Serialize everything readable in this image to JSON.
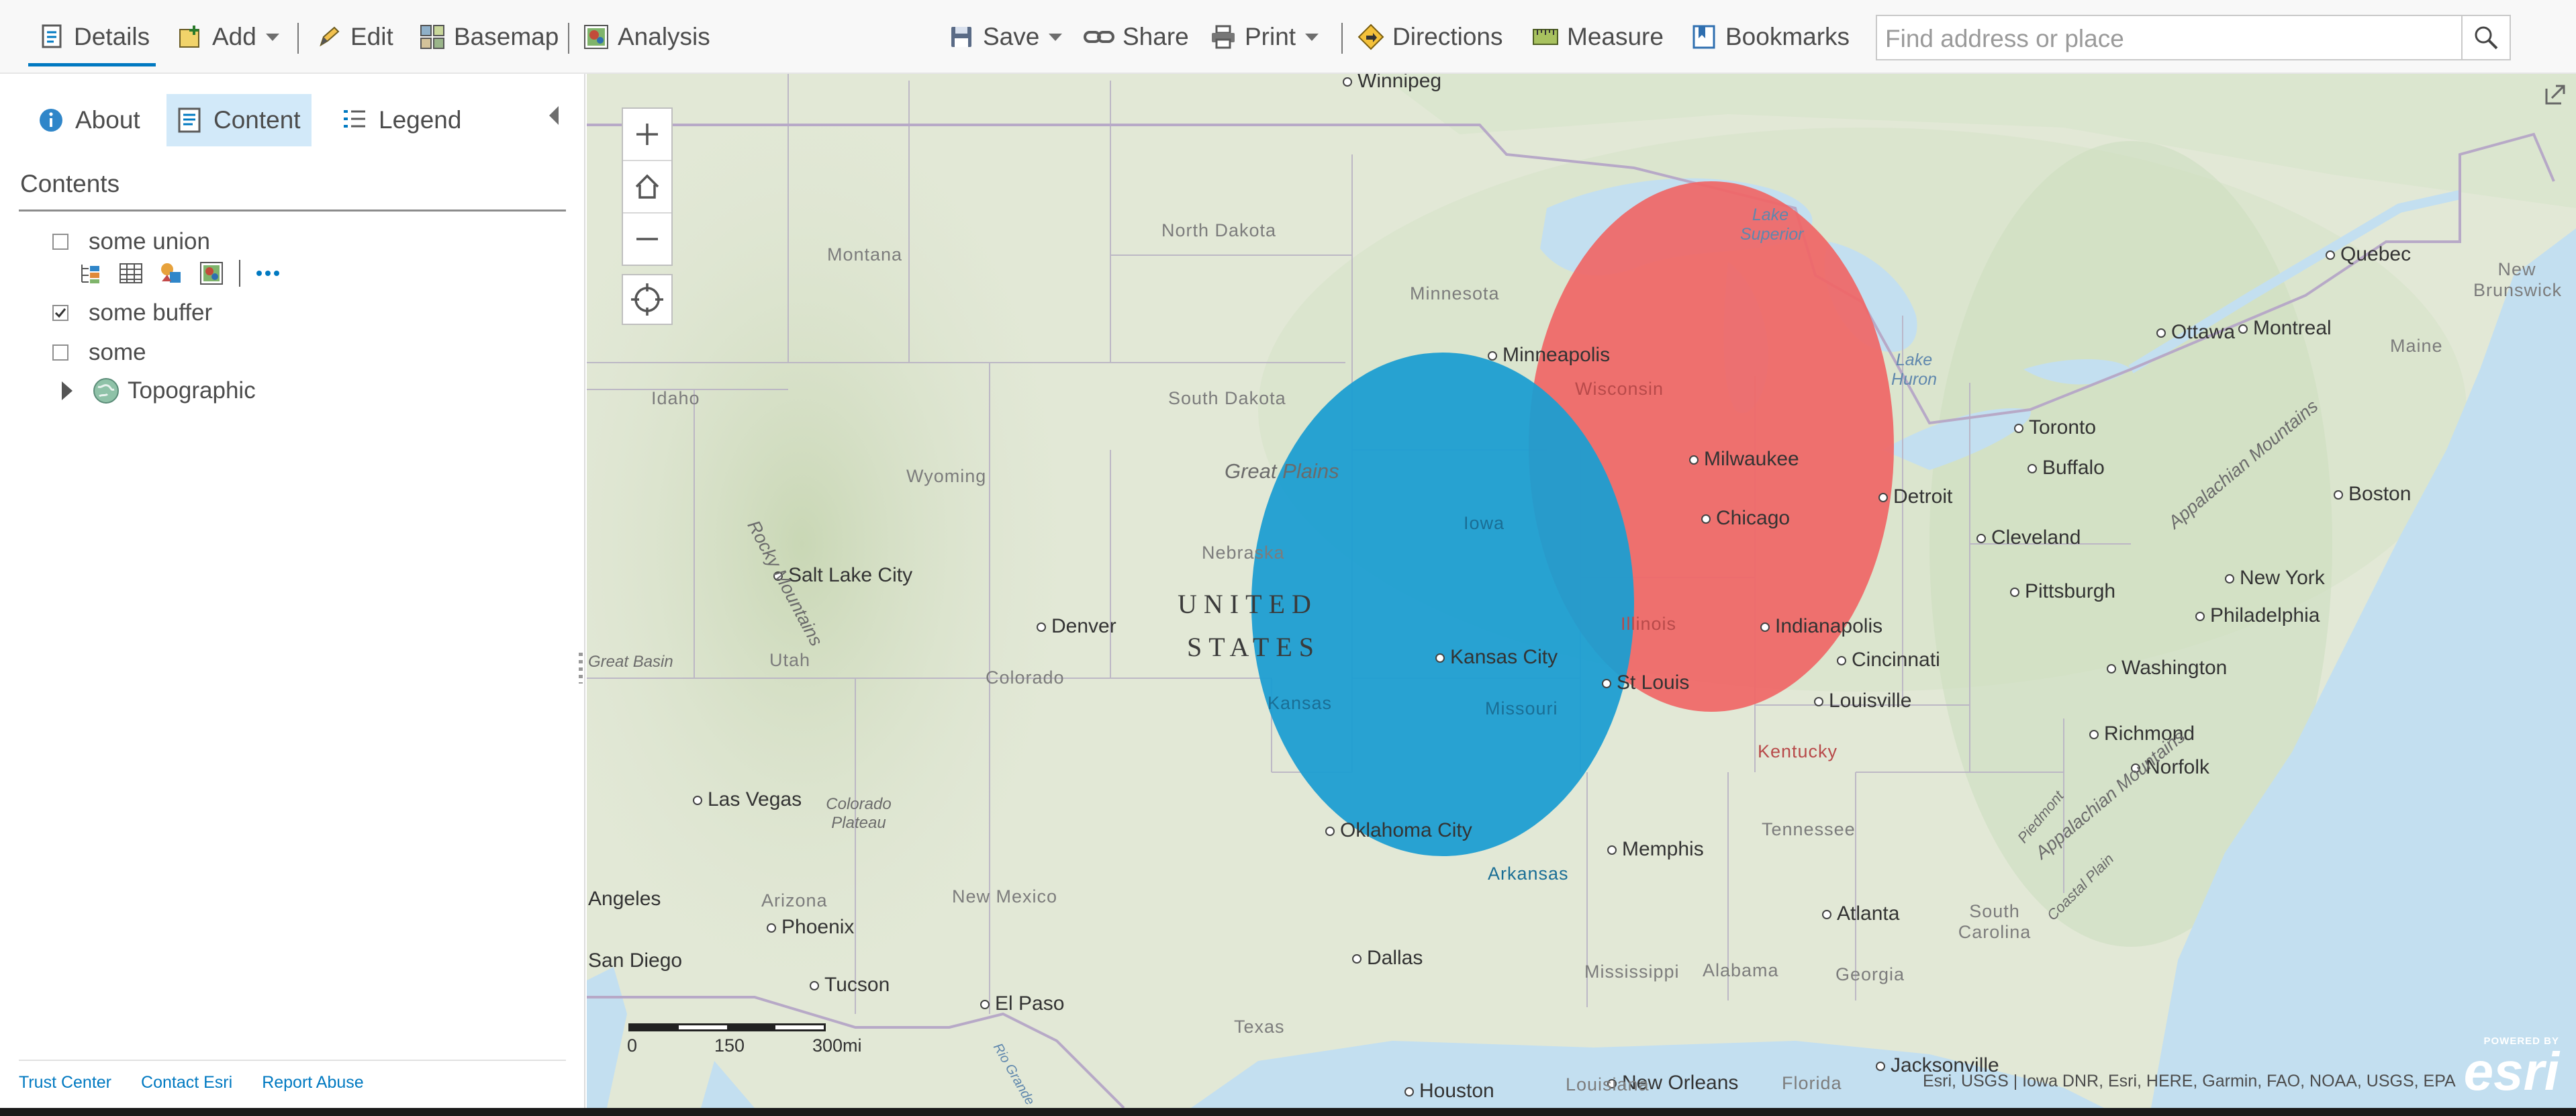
{
  "toolbar": {
    "details": "Details",
    "add": "Add",
    "edit": "Edit",
    "basemap": "Basemap",
    "analysis": "Analysis",
    "save": "Save",
    "share": "Share",
    "print": "Print",
    "directions": "Directions",
    "measure": "Measure",
    "bookmarks": "Bookmarks",
    "search_placeholder": "Find address or place"
  },
  "panel": {
    "tabs": {
      "about": "About",
      "content": "Content",
      "legend": "Legend"
    },
    "contents_title": "Contents",
    "layers": [
      {
        "label": "some union",
        "checked": false
      },
      {
        "label": "some buffer",
        "checked": true
      },
      {
        "label": "some",
        "checked": false
      },
      {
        "label": "Topographic",
        "checked": null
      }
    ],
    "footer": {
      "trust": "Trust Center",
      "contact": "Contact Esri",
      "abuse": "Report Abuse"
    }
  },
  "map": {
    "country": {
      "line1": "UNITED",
      "line2": "STATES"
    },
    "states": [
      "North Dakota",
      "Minnesota",
      "Montana",
      "South Dakota",
      "Wyoming",
      "Idaho",
      "Nebraska",
      "Iowa",
      "Wisconsin",
      "Illinois",
      "Kansas",
      "Missouri",
      "Colorado",
      "Utah",
      "Kentucky",
      "Tennessee",
      "Arkansas",
      "Arizona",
      "New Mexico",
      "Texas",
      "Mississippi",
      "Alabama",
      "Georgia",
      "South Carolina",
      "Louisiana",
      "Florida",
      "Maine",
      "New Brunswick"
    ],
    "cities": [
      "Winnipeg",
      "Minneapolis",
      "Milwaukee",
      "Chicago",
      "Detroit",
      "Toronto",
      "Buffalo",
      "Ottawa",
      "Montreal",
      "Quebec",
      "Boston",
      "Cleveland",
      "Pittsburgh",
      "New York",
      "Philadelphia",
      "Washington",
      "Richmond",
      "Norfolk",
      "Indianapolis",
      "Cincinnati",
      "Louisville",
      "St Louis",
      "Kansas City",
      "Oklahoma City",
      "Memphis",
      "Atlanta",
      "Dallas",
      "Houston",
      "New Orleans",
      "Jacksonville",
      "Salt Lake City",
      "Denver",
      "Las Vegas",
      "Phoenix",
      "Tucson",
      "El Paso",
      "San Diego",
      "Angeles"
    ],
    "water": [
      "Lake Superior",
      "Lake Huron"
    ],
    "features": [
      "Great Plains",
      "Rocky Mountains",
      "Great Basin",
      "Colorado Plateau",
      "Appalachian Mountains",
      "Piedmont",
      "Coastal Plain",
      "Rio Grande"
    ],
    "scale": {
      "l0": "0",
      "l1": "150",
      "l2": "300mi"
    },
    "attribution": "Esri, USGS | Iowa DNR, Esri, HERE, Garmin, FAO, NOAA, USGS, EPA",
    "logo": {
      "powered": "POWERED BY",
      "name": "esri"
    },
    "colors": {
      "union_fill": "#1c9dd1",
      "buffer_fill": "#f06666",
      "water": "#c0def0",
      "land": "#dfe6d3"
    }
  }
}
